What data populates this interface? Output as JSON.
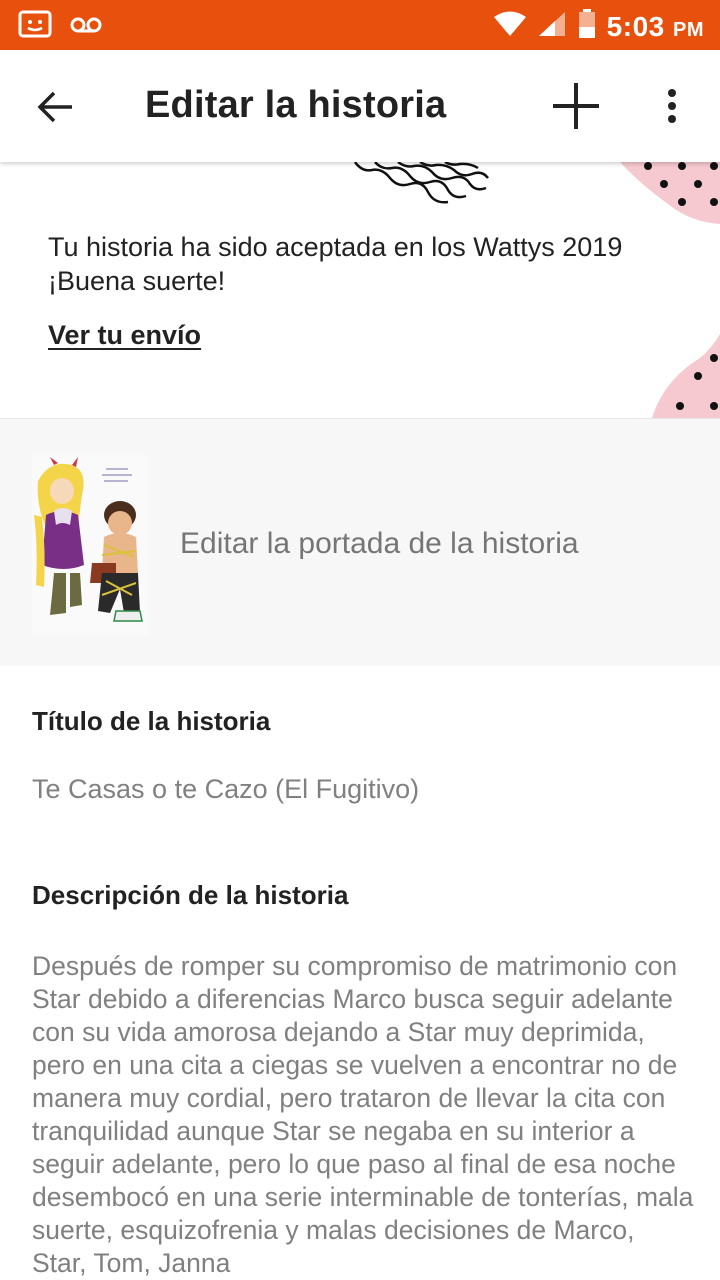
{
  "status_bar": {
    "time": "5:03",
    "ampm": "PM",
    "colors": {
      "background": "#e8500d"
    }
  },
  "app_bar": {
    "title": "Editar la historia"
  },
  "banner": {
    "message": "Tu historia ha sido aceptada en los Wattys 2019 ¡Buena suerte!",
    "link": "Ver tu envío"
  },
  "cover": {
    "label": "Editar la portada de la historia"
  },
  "story_title": {
    "label": "Título de la historia",
    "value": "Te Casas o te Cazo (El Fugitivo)"
  },
  "description": {
    "label": "Descripción de la historia",
    "value": "Después de romper su compromiso de matrimonio con Star debido a diferencias Marco busca seguir adelante con su vida amorosa dejando a Star muy deprimida, pero en una cita a ciegas se vuelven a encontrar no de manera muy cordial, pero trataron de llevar la cita con tranquilidad aunque Star se negaba en su interior a seguir adelante, pero lo que paso al final de esa noche desembocó en una serie interminable de tonterías, mala suerte, esquizofrenia y malas decisiones de Marco, Star, Tom, Janna"
  }
}
